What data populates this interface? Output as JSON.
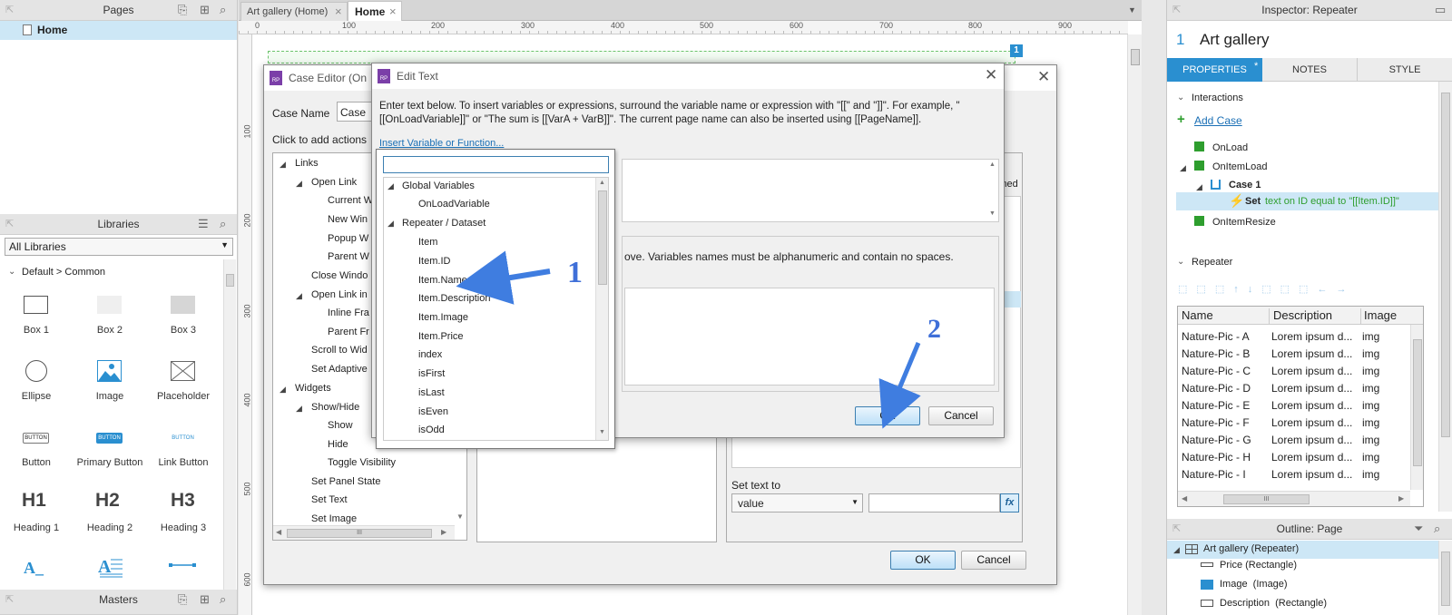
{
  "pages": {
    "title": "Pages",
    "home": "Home"
  },
  "tabs": {
    "first": "Art gallery (Home)",
    "second": "Home",
    "close": "×"
  },
  "ruler": {
    "h": [
      "0",
      "100",
      "200",
      "300",
      "400",
      "500",
      "600",
      "700",
      "800",
      "900"
    ],
    "v": [
      "100",
      "200",
      "300",
      "400",
      "500",
      "600"
    ]
  },
  "badge": "1",
  "libraries": {
    "title": "Libraries",
    "select": "All Libraries",
    "group": "Default > Common",
    "items": [
      "Box 1",
      "Box 2",
      "Box 3",
      "Ellipse",
      "Image",
      "Placeholder",
      "Button",
      "Primary Button",
      "Link Button",
      "Heading 1",
      "Heading 2",
      "Heading 3"
    ],
    "glyphs": {
      "button": "BUTTON",
      "h1": "H1",
      "h2": "H2",
      "h3": "H3",
      "textA": "A_"
    }
  },
  "masters": {
    "title": "Masters"
  },
  "case_editor": {
    "title": "Case Editor (On",
    "case_name_label": "Case Name",
    "case_name_value": "Case",
    "click_add": "Click to add actions",
    "tree": [
      "Links",
      "Open Link",
      "Current W",
      "New Win",
      "Popup W",
      "Parent W",
      "Close Windo",
      "Open Link in",
      "Inline Fra",
      "Parent Fr",
      "Scroll to Wid",
      "Set Adaptive",
      "Widgets",
      "Show/Hide",
      "Show",
      "Hide",
      "Toggle Visibility",
      "Set Panel State",
      "Set Text",
      "Set Image"
    ],
    "unnamed": "nnamed",
    "set_text_to": "Set text to",
    "value_select": "value",
    "fx": "fx",
    "ok": "OK",
    "cancel": "Cancel",
    "hscroll": "III"
  },
  "edit_text": {
    "title": "Edit Text",
    "desc": "Enter text below. To insert variables or expressions, surround the variable name or expression with \"[[\" and \"]]\". For example, \"[[OnLoadVariable]]\" or \"The sum is [[VarA + VarB]]\". The current page name can also be inserted using [[PageName]].",
    "insert_link": "Insert Variable or Function...",
    "var_note": "ove. Variables names must be alphanumeric and contain no spaces.",
    "ok": "OK",
    "cancel": "Cancel"
  },
  "var_list": {
    "groups": [
      {
        "label": "Global Variables",
        "items": [
          "OnLoadVariable"
        ]
      },
      {
        "label": "Repeater / Dataset",
        "items": [
          "Item",
          "Item.ID",
          "Item.Name",
          "Item.Description",
          "Item.Image",
          "Item.Price",
          "index",
          "isFirst",
          "isLast",
          "isEven",
          "isOdd"
        ]
      }
    ]
  },
  "annotations": {
    "one": "1",
    "two": "2"
  },
  "inspector": {
    "title": "Inspector: Repeater",
    "num": "1",
    "name": "Art gallery",
    "tabs": [
      "PROPERTIES",
      "NOTES",
      "STYLE"
    ],
    "tab_marker": "*",
    "interactions_label": "Interactions",
    "add_case": "Add Case",
    "events": {
      "onload": "OnLoad",
      "onitemload": "OnItemLoad",
      "case1": "Case 1",
      "action_prefix": "Set",
      "action_rest": "text on ID equal to \"[[Item.ID]]\"",
      "onitemresize": "OnItemResize"
    },
    "repeater_label": "Repeater",
    "grid": {
      "columns": [
        "Name",
        "Description",
        "Image"
      ],
      "rows": [
        [
          "Nature-Pic - A",
          "Lorem ipsum d...",
          "img"
        ],
        [
          "Nature-Pic - B",
          "Lorem ipsum d...",
          "img"
        ],
        [
          "Nature-Pic - C",
          "Lorem ipsum d...",
          "img"
        ],
        [
          "Nature-Pic - D",
          "Lorem ipsum d...",
          "img"
        ],
        [
          "Nature-Pic - E",
          "Lorem ipsum d...",
          "img"
        ],
        [
          "Nature-Pic - F",
          "Lorem ipsum d...",
          "img"
        ],
        [
          "Nature-Pic - G",
          "Lorem ipsum d...",
          "img"
        ],
        [
          "Nature-Pic - H",
          "Lorem ipsum d...",
          "img"
        ],
        [
          "Nature-Pic - I",
          "Lorem ipsum d...",
          "img"
        ]
      ],
      "hscroll": "III"
    }
  },
  "outline": {
    "title": "Outline: Page",
    "items": [
      "Art gallery (Repeater)",
      "Price (Rectangle)",
      "Image  (Image)",
      "Description  (Rectangle)"
    ]
  },
  "colors": {
    "accent": "#2a8fd0",
    "selection": "#cfe8f7",
    "canvas": "#ffffff",
    "arrow": "#3f7de0",
    "green": "#2e9e2e"
  }
}
